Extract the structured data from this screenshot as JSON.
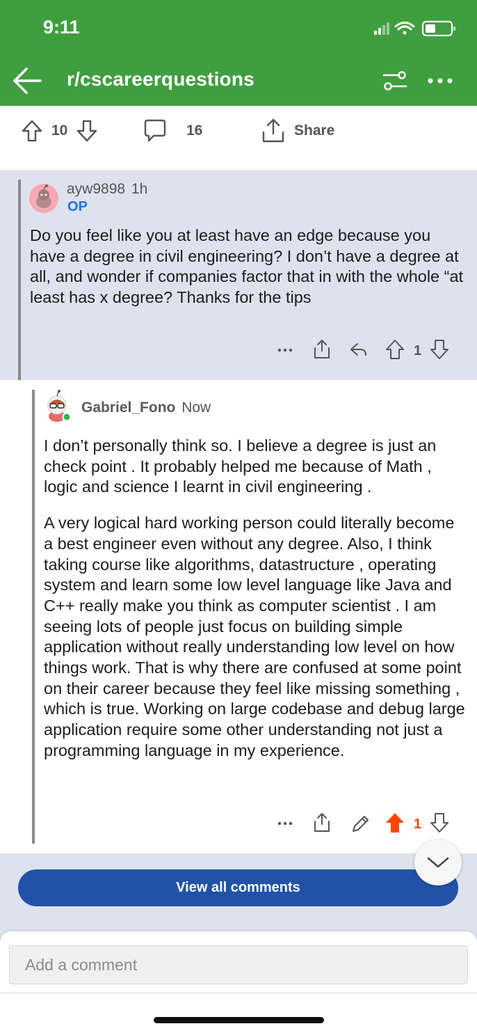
{
  "status_bar": {
    "time": "9:11"
  },
  "nav": {
    "title": "r/cscareerquestions",
    "back_icon": "arrow-left-icon",
    "filter_icon": "sliders-icon",
    "more_icon": "more-horizontal-icon"
  },
  "post_actions": {
    "votes": "10",
    "comments": "16",
    "share_label": "Share"
  },
  "parent_comment": {
    "author": "ayw9898",
    "time": "1h",
    "op_badge": "OP",
    "body": "Do you feel like you at least have an edge because you have a degree in civil engineering? I don’t have a degree at all, and wonder if companies factor that in with the whole “at least has x degree? Thanks for the tips",
    "votes": "1"
  },
  "reply": {
    "author": "Gabriel_Fono",
    "time": "Now",
    "paragraphs": [
      "I don’t personally think so. I believe a degree is just an check point . It probably helped me because of Math , logic and science I learnt in civil engineering .",
      "A very logical hard working person could literally become a best engineer even without any degree. Also, I think taking course like algorithms, datastructure , operating system and learn some low level language like Java and C++ really make you think as computer scientist . I am seeing lots of people just focus on building simple application without really understanding low level on how things work. That is why there are confused at some point on their career because they feel like missing something , which is true. Working on large codebase and debug large application require some other understanding not just a programming language in my experience."
    ],
    "votes": "1",
    "upvoted": true
  },
  "view_all_label": "View all comments",
  "composer": {
    "placeholder": "Add a comment"
  },
  "colors": {
    "header_green": "#3f9f3f",
    "comment_bg": "#dee2ee",
    "op_blue": "#1a73e8",
    "upvote_orange": "#ff4500",
    "button_blue": "#2152a7"
  }
}
